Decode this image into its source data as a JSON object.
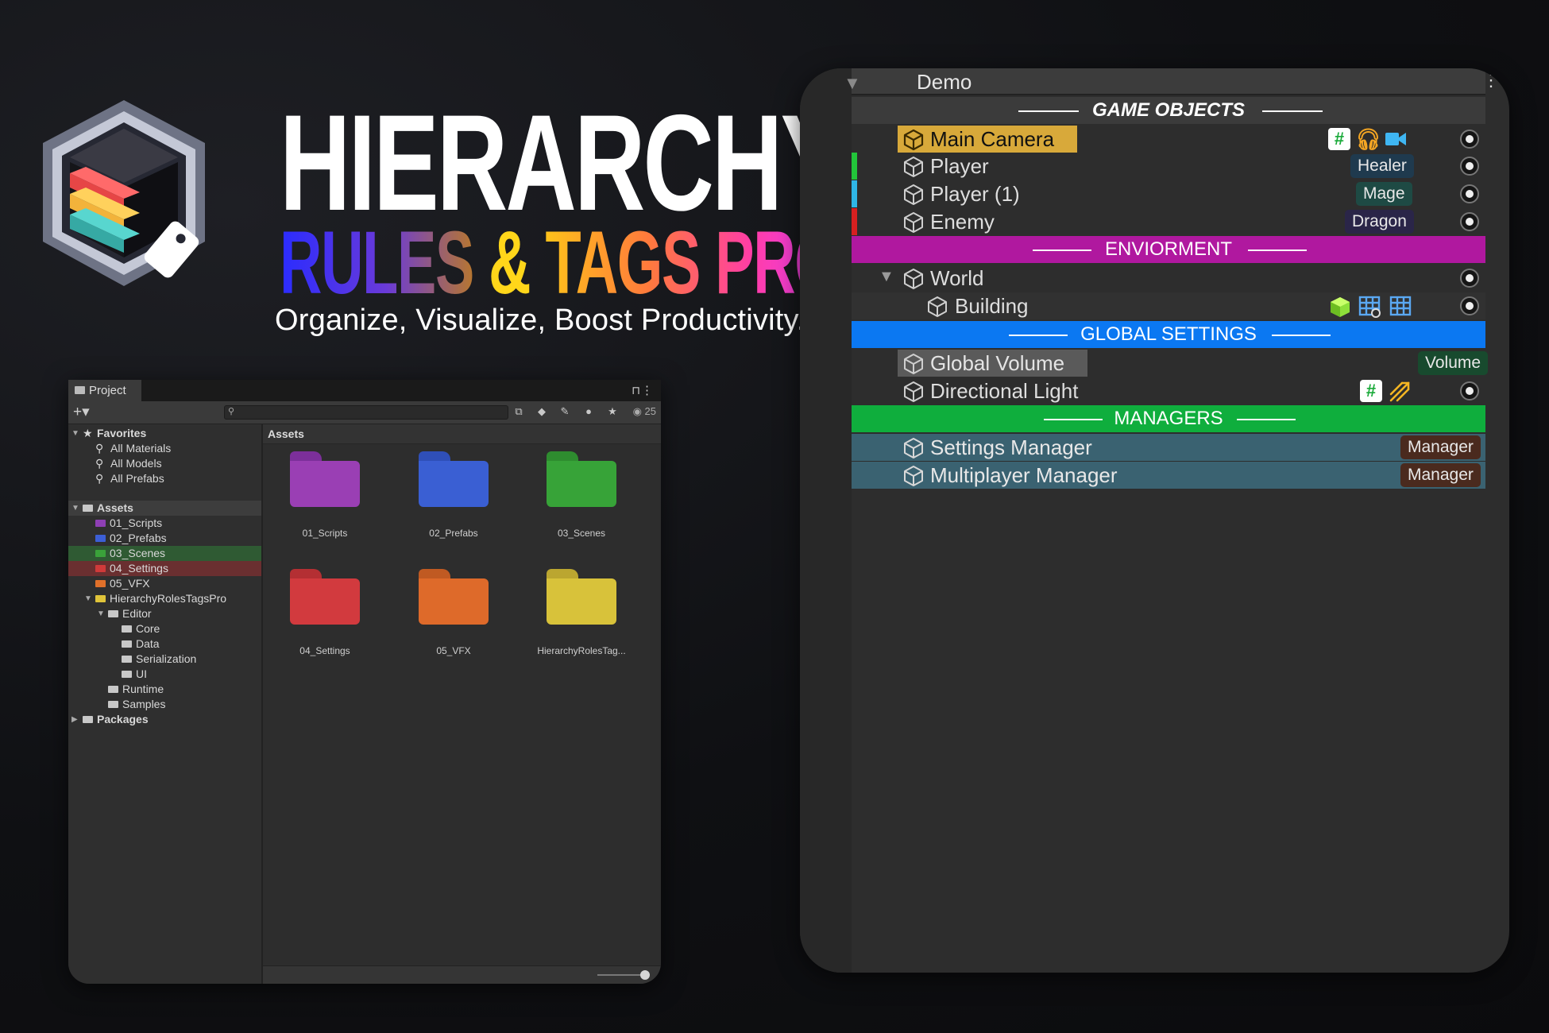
{
  "brand": {
    "title_line1": "HIERARCHY",
    "title_word1": "RULES",
    "title_amp": "&",
    "title_word2": "TAGS PRO",
    "subtitle": "Organize, Visualize, Boost Productivity."
  },
  "project": {
    "tab_label": "Project",
    "lock_glyph": "🔒",
    "search_placeholder": "",
    "visible_count": "25",
    "breadcrumb": "Assets",
    "tree": [
      {
        "label": "Favorites",
        "bold": true,
        "expanded": true,
        "depth": 0,
        "icon": "star-icon"
      },
      {
        "label": "All Materials",
        "depth": 1,
        "icon": "search-icon"
      },
      {
        "label": "All Models",
        "depth": 1,
        "icon": "search-icon"
      },
      {
        "label": "All Prefabs",
        "depth": 1,
        "icon": "search-icon"
      },
      {
        "label": "Assets",
        "bold": true,
        "expanded": true,
        "depth": 0,
        "icon": "folder-open-icon"
      },
      {
        "label": "01_Scripts",
        "depth": 1,
        "color": "#8e3fb4"
      },
      {
        "label": "02_Prefabs",
        "depth": 1,
        "color": "#3c5fd6"
      },
      {
        "label": "03_Scenes",
        "depth": 1,
        "color": "#3aa23a",
        "highlight": "green"
      },
      {
        "label": "04_Settings",
        "depth": 1,
        "color": "#d03a3a",
        "highlight": "red"
      },
      {
        "label": "05_VFX",
        "depth": 1,
        "color": "#e0702a"
      },
      {
        "label": "HierarchyRolesTagsPro",
        "depth": 1,
        "color": "#e0c43a",
        "expanded": true
      },
      {
        "label": "Editor",
        "depth": 2,
        "expanded": true,
        "icon": "folder-open-icon"
      },
      {
        "label": "Core",
        "depth": 3
      },
      {
        "label": "Data",
        "depth": 3
      },
      {
        "label": "Serialization",
        "depth": 3
      },
      {
        "label": "UI",
        "depth": 3
      },
      {
        "label": "Runtime",
        "depth": 2
      },
      {
        "label": "Samples",
        "depth": 2
      },
      {
        "label": "Packages",
        "bold": true,
        "depth": 0,
        "collapsed": true
      }
    ],
    "folders": [
      {
        "label": "01_Scripts",
        "color": "#9a3fb4"
      },
      {
        "label": "02_Prefabs",
        "color": "#3a5fd3"
      },
      {
        "label": "03_Scenes",
        "color": "#37a338"
      },
      {
        "label": "04_Settings",
        "color": "#d23a3e"
      },
      {
        "label": "05_VFX",
        "color": "#de6a2a"
      },
      {
        "label": "HierarchyRolesTag...",
        "color": "#d8c23a"
      }
    ],
    "zoom_level": 1.0
  },
  "hierarchy": {
    "scene": "Demo",
    "separators": {
      "game_objects": "GAME OBJECTS",
      "enviorment": "ENVIORMENT",
      "global_settings": "GLOBAL SETTINGS",
      "managers": "MANAGERS"
    },
    "rows": {
      "main_camera": {
        "name": "Main Camera"
      },
      "player": {
        "name": "Player",
        "tag": "Healer"
      },
      "player1": {
        "name": "Player (1)",
        "tag": "Mage"
      },
      "enemy": {
        "name": "Enemy",
        "tag": "Dragon"
      },
      "world": {
        "name": "World"
      },
      "building": {
        "name": "Building"
      },
      "global_volume": {
        "name": "Global Volume",
        "tag": "Volume"
      },
      "directional_light": {
        "name": "Directional Light"
      },
      "settings_manager": {
        "name": "Settings Manager",
        "tag": "Manager"
      },
      "multiplayer_manager": {
        "name": "Multiplayer Manager",
        "tag": "Manager"
      }
    },
    "colors": {
      "game_objects_sep": "#3b3b3b",
      "enviorment_sep": "#b0189f",
      "global_settings_sep": "#0b78f2",
      "managers_sep": "#0fae3d",
      "main_camera_highlight": "#d8a93a",
      "manager_rows": "#3a6271"
    }
  }
}
